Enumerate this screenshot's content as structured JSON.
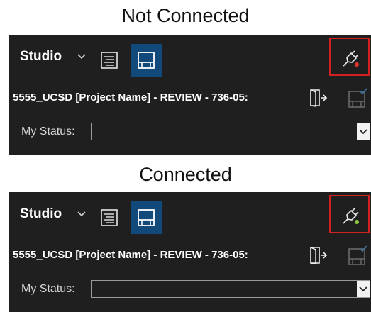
{
  "sections": [
    {
      "heading": "Not Connected",
      "studio_label": "Studio",
      "project_title": "5555_UCSD [Project Name] - REVIEW - 736-05:",
      "status_label": "My Status:",
      "status_value": "",
      "connection_state": "disconnected",
      "connection_dot_color": "#e0342f"
    },
    {
      "heading": "Connected",
      "studio_label": "Studio",
      "project_title": "5555_UCSD [Project Name] - REVIEW - 736-05:",
      "status_label": "My Status:",
      "status_value": "",
      "connection_state": "connected",
      "connection_dot_color": "#8cc63f"
    }
  ],
  "colors": {
    "panel_bg": "#1f1f1f",
    "active_tool_bg": "#114a7a",
    "highlight_frame": "#d32020"
  },
  "icons": [
    "chevron-down-icon",
    "list-icon",
    "layout-icon",
    "plug-icon",
    "exit-icon",
    "panel-check-icon",
    "dropdown-arrow-icon"
  ]
}
